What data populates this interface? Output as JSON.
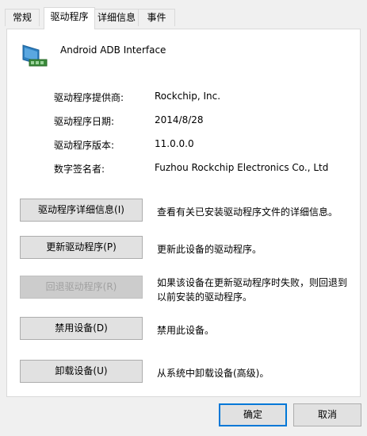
{
  "tabs": [
    "常规",
    "驱动程序",
    "详细信息",
    "事件"
  ],
  "device": {
    "name": "Android ADB Interface",
    "icon": "network-adapter-icon"
  },
  "info": [
    {
      "label": "驱动程序提供商:",
      "value": "Rockchip, Inc."
    },
    {
      "label": "驱动程序日期:",
      "value": "2014/8/28"
    },
    {
      "label": "驱动程序版本:",
      "value": "11.0.0.0"
    },
    {
      "label": "数字签名者:",
      "value": "Fuzhou Rockchip Electronics Co., Ltd"
    }
  ],
  "actions": [
    {
      "label": "驱动程序详细信息(I)",
      "desc": "查看有关已安装驱动程序文件的详细信息。",
      "enabled": true
    },
    {
      "label": "更新驱动程序(P)",
      "desc": "更新此设备的驱动程序。",
      "enabled": true
    },
    {
      "label": "回退驱动程序(R)",
      "desc": "如果该设备在更新驱动程序时失败，则回退到以前安装的驱动程序。",
      "enabled": false
    },
    {
      "label": "禁用设备(D)",
      "desc": "禁用此设备。",
      "enabled": true
    },
    {
      "label": "卸载设备(U)",
      "desc": "从系统中卸载设备(高级)。",
      "enabled": true
    }
  ],
  "dialog": {
    "ok": "确定",
    "cancel": "取消"
  }
}
